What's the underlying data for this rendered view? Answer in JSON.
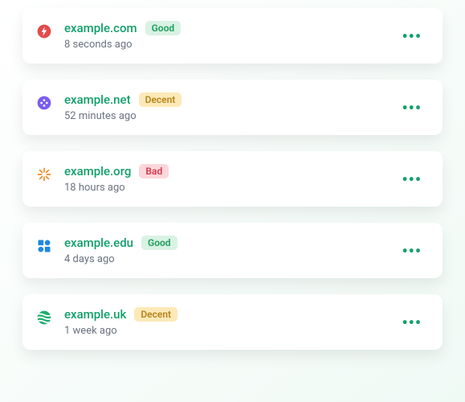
{
  "badges": {
    "good": "Good",
    "decent": "Decent",
    "bad": "Bad"
  },
  "items": [
    {
      "domain": "example.com",
      "status": "good",
      "timestamp": "8 seconds ago",
      "icon": "bolt",
      "icon_color": "#e24b4b"
    },
    {
      "domain": "example.net",
      "status": "decent",
      "timestamp": "52 minutes ago",
      "icon": "dots",
      "icon_color": "#7b5cf0"
    },
    {
      "domain": "example.org",
      "status": "bad",
      "timestamp": "18 hours ago",
      "icon": "burst",
      "icon_color": "#f08a24"
    },
    {
      "domain": "example.edu",
      "status": "good",
      "timestamp": "4 days ago",
      "icon": "tiles",
      "icon_color": "#1e88e5"
    },
    {
      "domain": "example.uk",
      "status": "decent",
      "timestamp": "1 week ago",
      "icon": "globe",
      "icon_color": "#1fae70"
    }
  ]
}
